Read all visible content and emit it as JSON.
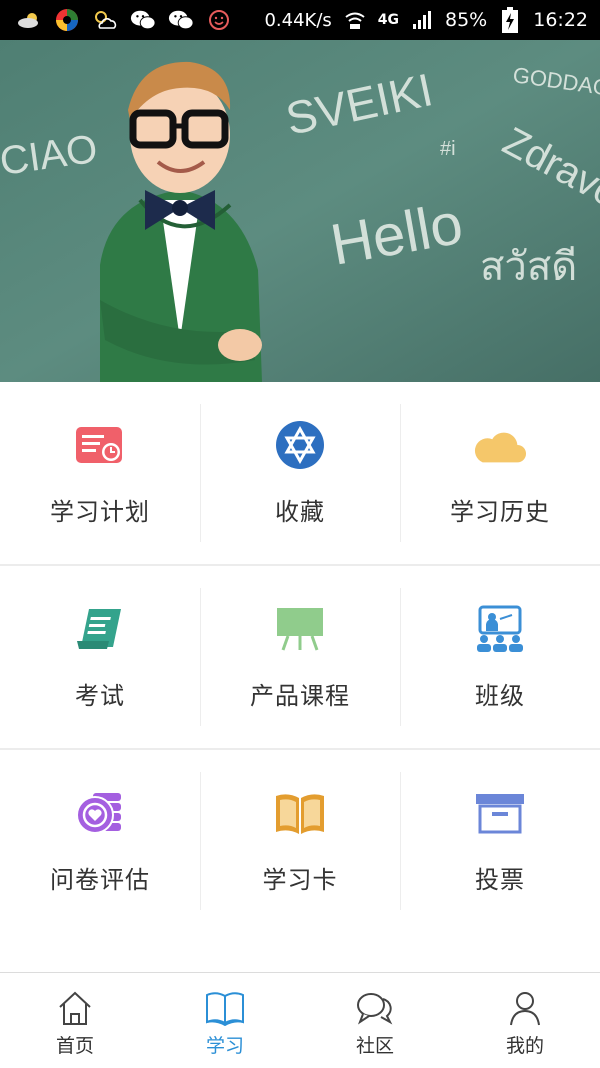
{
  "status_bar": {
    "network_speed": "0.44K/s",
    "network_type": "4G",
    "battery": "85%",
    "time": "16:22",
    "icons": [
      "weather-cloud-icon",
      "app-circle-icon",
      "weather-sun-icon",
      "wechat-icon",
      "wechat-icon",
      "face-icon",
      "wifi-icon",
      "signal-icon",
      "battery-charging-icon"
    ]
  },
  "banner": {
    "board_words": [
      "CIAO",
      "SVEIKI",
      "GODDAG",
      "Zdravo",
      "#i",
      "Hello",
      "สวัสดี"
    ]
  },
  "menu": {
    "rows": [
      [
        {
          "label": "学习计划",
          "icon": "study-plan-icon",
          "color": "#f0606a"
        },
        {
          "label": "收藏",
          "icon": "star-of-david-icon",
          "color": "#2d6fc0"
        },
        {
          "label": "学习历史",
          "icon": "cloud-icon",
          "color": "#f5c76a"
        }
      ],
      [
        {
          "label": "考试",
          "icon": "exam-scroll-icon",
          "color": "#34a38c"
        },
        {
          "label": "产品课程",
          "icon": "blackboard-icon",
          "color": "#90cc8c"
        },
        {
          "label": "班级",
          "icon": "classroom-icon",
          "color": "#3b8fd6"
        }
      ],
      [
        {
          "label": "问卷评估",
          "icon": "survey-coins-icon",
          "color": "#a45fe0"
        },
        {
          "label": "学习卡",
          "icon": "book-icon",
          "color": "#e39d2f"
        },
        {
          "label": "投票",
          "icon": "vote-box-icon",
          "color": "#6b86d8"
        }
      ]
    ]
  },
  "tabbar": {
    "active": "学习",
    "active_color": "#2b8fd6",
    "items": [
      {
        "label": "首页",
        "icon": "home-icon"
      },
      {
        "label": "学习",
        "icon": "open-book-icon"
      },
      {
        "label": "社区",
        "icon": "chat-bubbles-icon"
      },
      {
        "label": "我的",
        "icon": "person-icon"
      }
    ]
  }
}
